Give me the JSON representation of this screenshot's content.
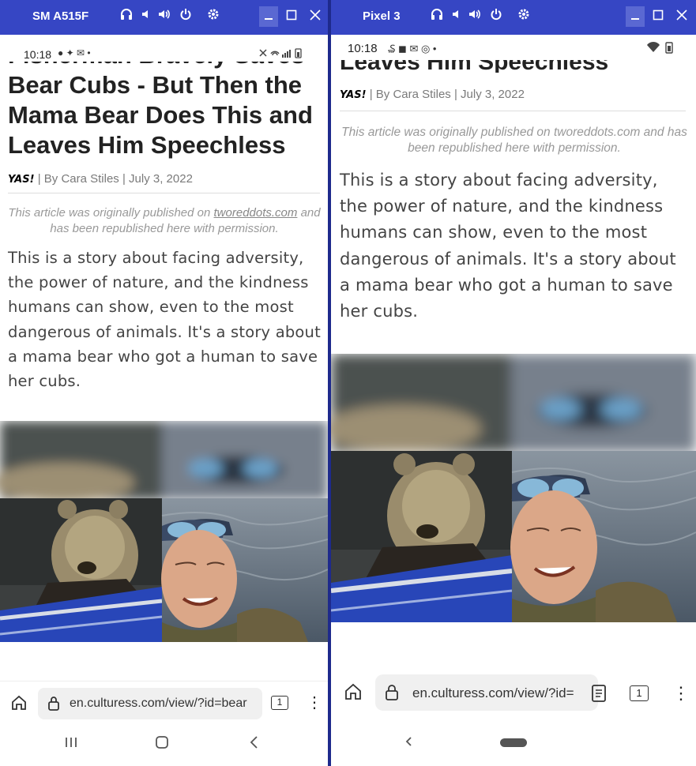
{
  "left": {
    "device": "SM A515F",
    "time": "10:18",
    "headline_top": "Fisherman Bravely Saves",
    "headline": "Bear Cubs - But Then the Mama Bear Does This and Leaves Him Speechless",
    "logo": "YAS!",
    "byline": "| By Cara Stiles | July 3, 2022",
    "note_prefix": "This article was originally published on ",
    "note_link": "tworeddots.com",
    "note_suffix": " and has been republished here with permission.",
    "lead": "This is a story about facing adversity, the power of nature, and the kindness humans can show, even to the most dangerous of animals. It's a story about a mama bear who got a human to save her cubs.",
    "url": "en.culturess.com/view/?id=bear",
    "tab_count": "1"
  },
  "right": {
    "device": "Pixel 3",
    "time": "10:18",
    "headline": "Leaves Him Speechless",
    "logo": "YAS!",
    "byline": "| By Cara Stiles | July 3, 2022",
    "note": "This article was originally published on tworeddots.com and has been republished here with permission.",
    "lead": "This is a story about facing adversity, the power of nature, and the kindness humans can show, even to the most dangerous of animals. It's a story about a mama bear who got a human to save her cubs.",
    "url": "en.culturess.com/view/?id=",
    "tab_count": "1"
  },
  "icons": {
    "headset": "headset-icon",
    "volume_down": "volume-down-icon",
    "volume_up": "volume-up-icon",
    "power": "power-icon",
    "settings": "gear-icon",
    "minimize": "minimize-icon",
    "maximize": "maximize-icon",
    "close": "close-icon"
  },
  "colors": {
    "titlebar": "#3646c4",
    "frame": "#1e2a8c",
    "text": "#222222"
  }
}
